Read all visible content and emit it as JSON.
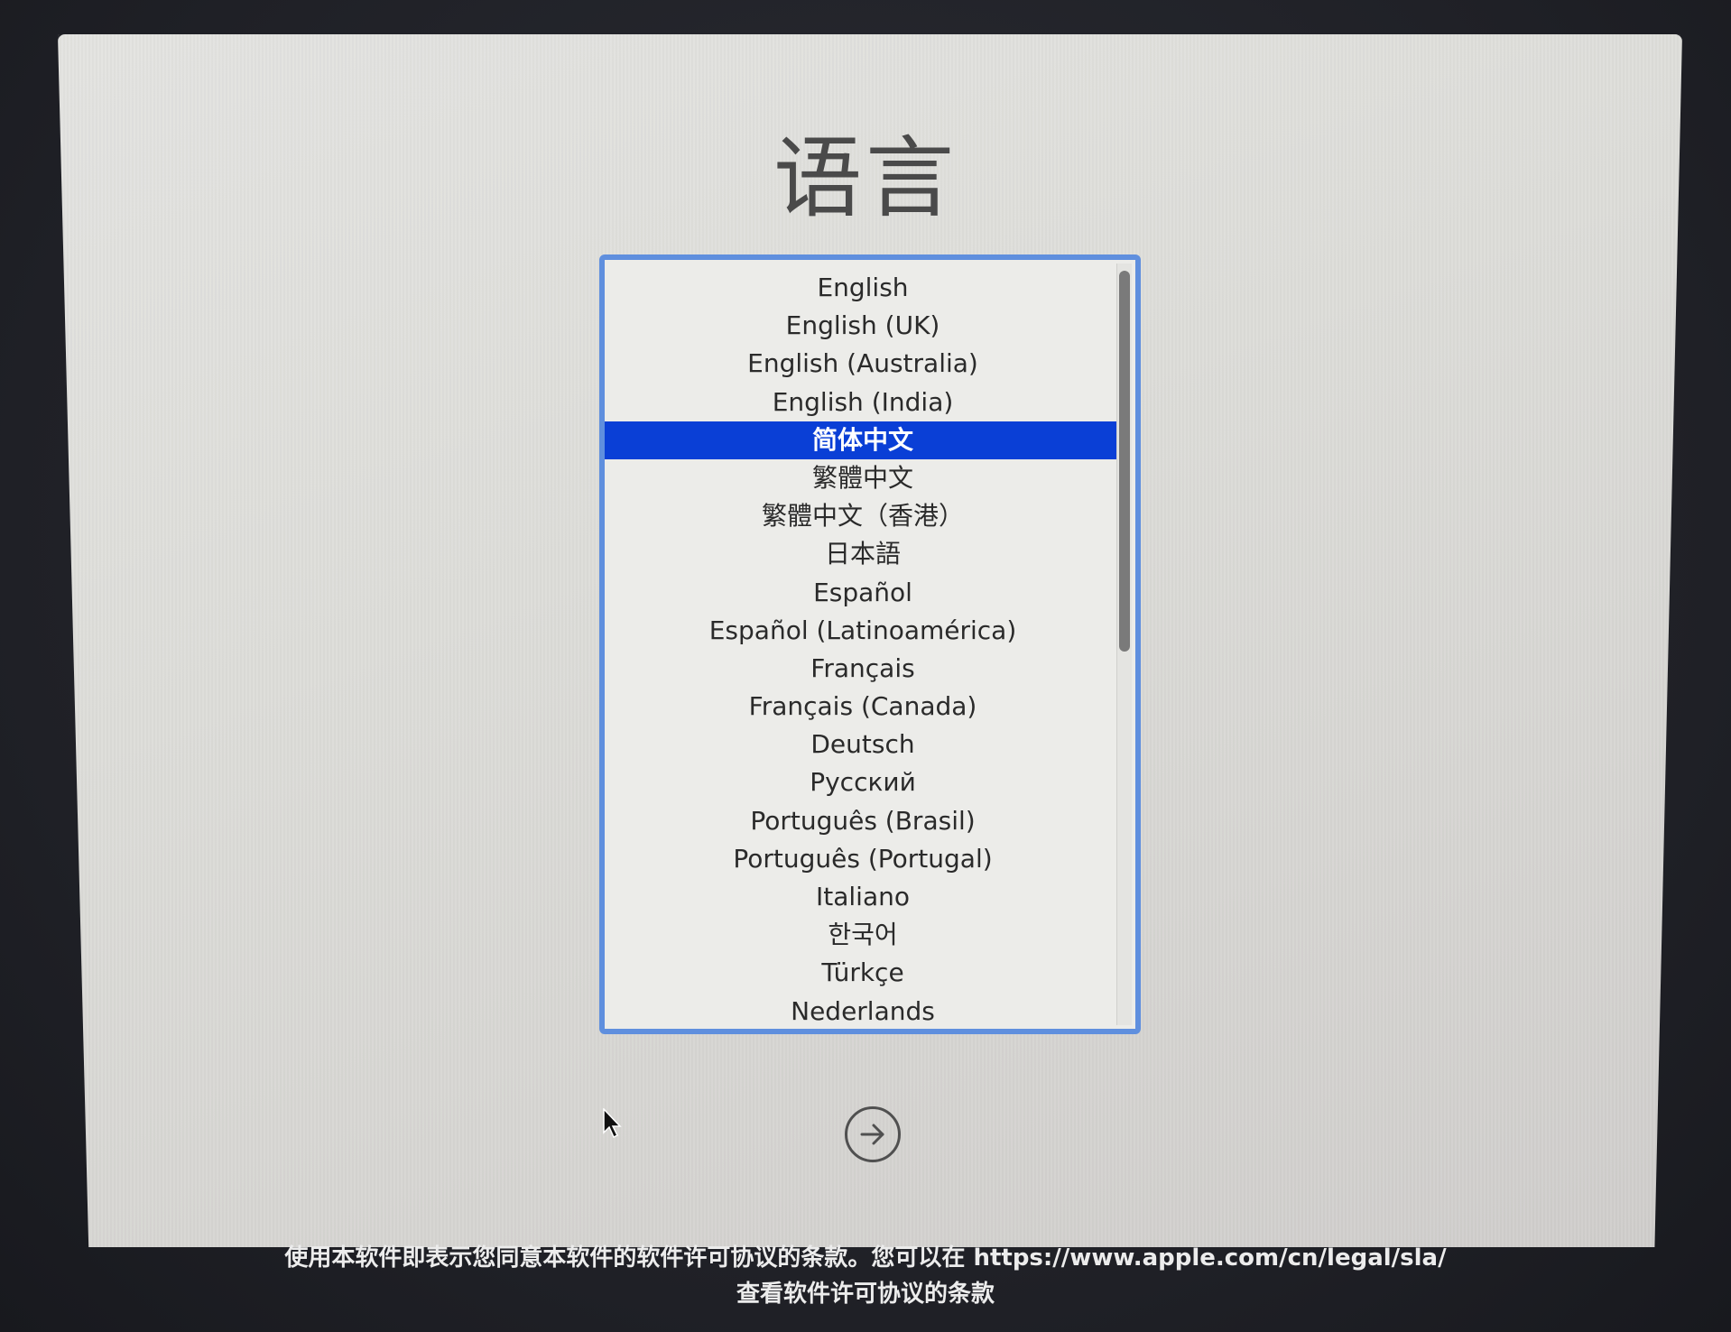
{
  "title": "语言",
  "languages": [
    "English",
    "English (UK)",
    "English (Australia)",
    "English (India)",
    "简体中文",
    "繁體中文",
    "繁體中文（香港）",
    "日本語",
    "Español",
    "Español (Latinoamérica)",
    "Français",
    "Français (Canada)",
    "Deutsch",
    "Русский",
    "Português (Brasil)",
    "Português (Portugal)",
    "Italiano",
    "한국어",
    "Türkçe",
    "Nederlands"
  ],
  "selected_language": "简体中文",
  "next_button_icon": "arrow-right-circle-icon",
  "footer": {
    "line1": "使用本软件即表示您同意本软件的软件许可协议的条款。您可以在 https://www.apple.com/cn/legal/sla/",
    "line2": "查看软件许可协议的条款"
  },
  "colors": {
    "selection": "#0a3fd6",
    "focus_ring": "#5f8fde"
  }
}
